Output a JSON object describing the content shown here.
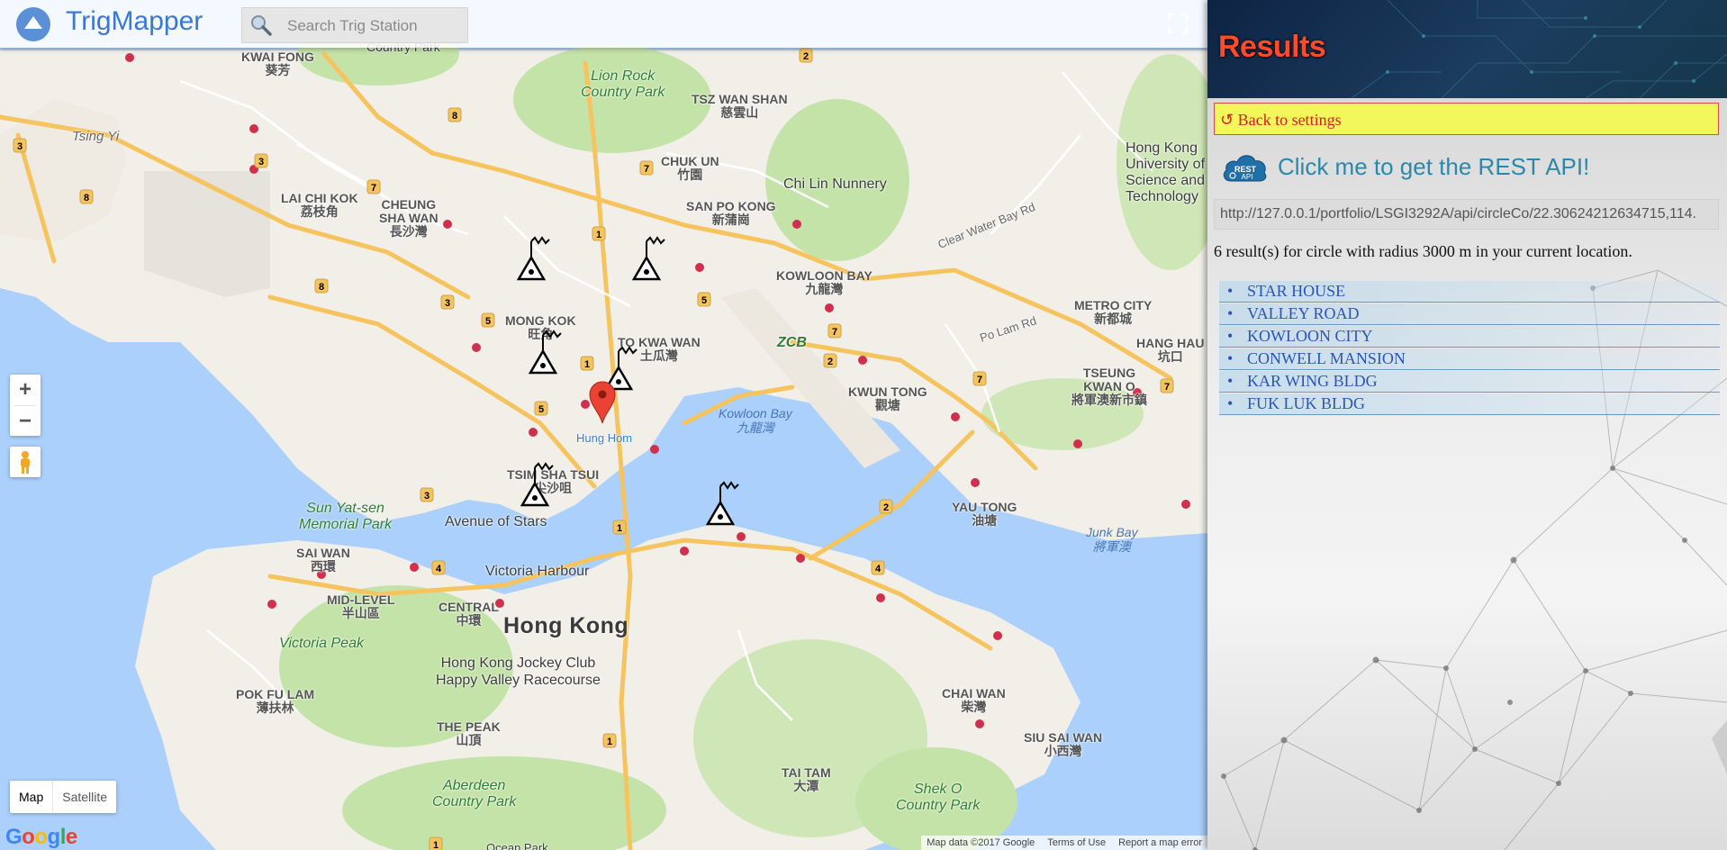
{
  "header": {
    "app_title": "TrigMapper",
    "search_placeholder": "Search Trig Station"
  },
  "map": {
    "zoom_in": "+",
    "zoom_out": "−",
    "map_type": [
      "Map",
      "Satellite"
    ],
    "active_map_type": "Map",
    "google_logo": "Google",
    "attribution": [
      "Map data ©2017 Google",
      "Terms of Use",
      "Report a map error"
    ],
    "labels": {
      "hong_kong": "Hong Kong",
      "kwai_fong": "KWAI FONG\n葵芳",
      "tsing_yi": "Tsing Yi",
      "lion_rock": "Lion Rock\nCountry Park",
      "tsz_wan_shan": "TSZ WAN SHAN\n慈雲山",
      "chuk_un": "CHUK UN\n竹園",
      "chi_lin": "Chi Lin Nunnery",
      "san_po_kong": "SAN PO KONG\n新蒲崗",
      "lai_chi_kok": "LAI CHI KOK\n荔枝角",
      "cheung_sha_wan": "CHEUNG\nSHA WAN\n長沙灣",
      "kowloon_bay": "KOWLOON BAY\n九龍灣",
      "mong_kok": "MONG KOK\n旺角",
      "to_kwa_wan": "TO KWA WAN\n土瓜灣",
      "zcb": "ZCB",
      "kwun_tong": "KWUN TONG\n觀塘",
      "kowloon_bay_water": "Kowloon Bay\n九龍灣",
      "hung_hom": "Hung Hom",
      "tsim_sha_tsui": "TSIM SHA TSUI\n尖沙咀",
      "sun_yat_sen": "Sun Yat-sen\nMemorial Park",
      "avenue_of_stars": "Avenue of Stars",
      "victoria_harbour": "Victoria Harbour",
      "sai_wan": "SAI WAN\n西環",
      "mid_level": "MID-LEVEL\n半山區",
      "central": "CENTRAL\n中環",
      "victoria_peak": "Victoria Peak",
      "pok_fu_lam": "POK FU LAM\n薄扶林",
      "jockey_club": "Hong Kong Jockey Club\nHappy Valley Racecourse",
      "the_peak": "THE PEAK\n山頂",
      "aberdeen": "Aberdeen\nCountry Park",
      "chai_wan": "CHAI WAN\n柴灣",
      "siu_sai_wan": "SIU SAI WAN\n小西灣",
      "tai_tam": "TAI TAM\n大潭",
      "shek_o": "Shek O\nCountry Park",
      "yau_tong": "YAU TONG\n油塘",
      "junk_bay": "Junk Bay\n將軍澳",
      "metro_city": "METRO CITY\n新都城",
      "tseung_kwan_o": "TSEUNG\nKWAN O\n將軍澳新市鎮",
      "hang_hau": "HANG HAU\n坑口",
      "hkust": "Hong Kong\nUniversity of\nScience and\nTechnology",
      "clear_water_bay_rd": "Clear Water Bay Rd",
      "country_park_top": "Country Park",
      "po_lam_rd": "Po Lam Rd",
      "ocean_park": "Ocean Park"
    }
  },
  "panel": {
    "title": "Results",
    "back_button": "↺ Back to settings",
    "rest_api_label": "Click me to get the REST API!",
    "rest_icon_text_1": "REST",
    "rest_icon_text_2": "API",
    "api_url": "http://127.0.0.1/portfolio/LSGI3292A/api/circleCo/22.30624212634715,114.",
    "result_count": "6 result(s) for circle with radius 3000 m in your current location.",
    "results": [
      {
        "bullet": "•",
        "name": "STAR HOUSE"
      },
      {
        "bullet": "•",
        "name": "VALLEY ROAD"
      },
      {
        "bullet": "•",
        "name": "KOWLOON CITY"
      },
      {
        "bullet": "•",
        "name": "CONWELL MANSION"
      },
      {
        "bullet": "•",
        "name": "KAR WING BLDG"
      },
      {
        "bullet": "•",
        "name": "FUK LUK BLDG"
      }
    ]
  },
  "colors": {
    "water": "#aad0fb",
    "land": "#f2efe9",
    "park": "#c4e3a8",
    "road": "#f6c45f",
    "panel_title": "#ff4b2b",
    "back_button_bg": "#f3f85a",
    "link_blue": "#2a55b6"
  }
}
